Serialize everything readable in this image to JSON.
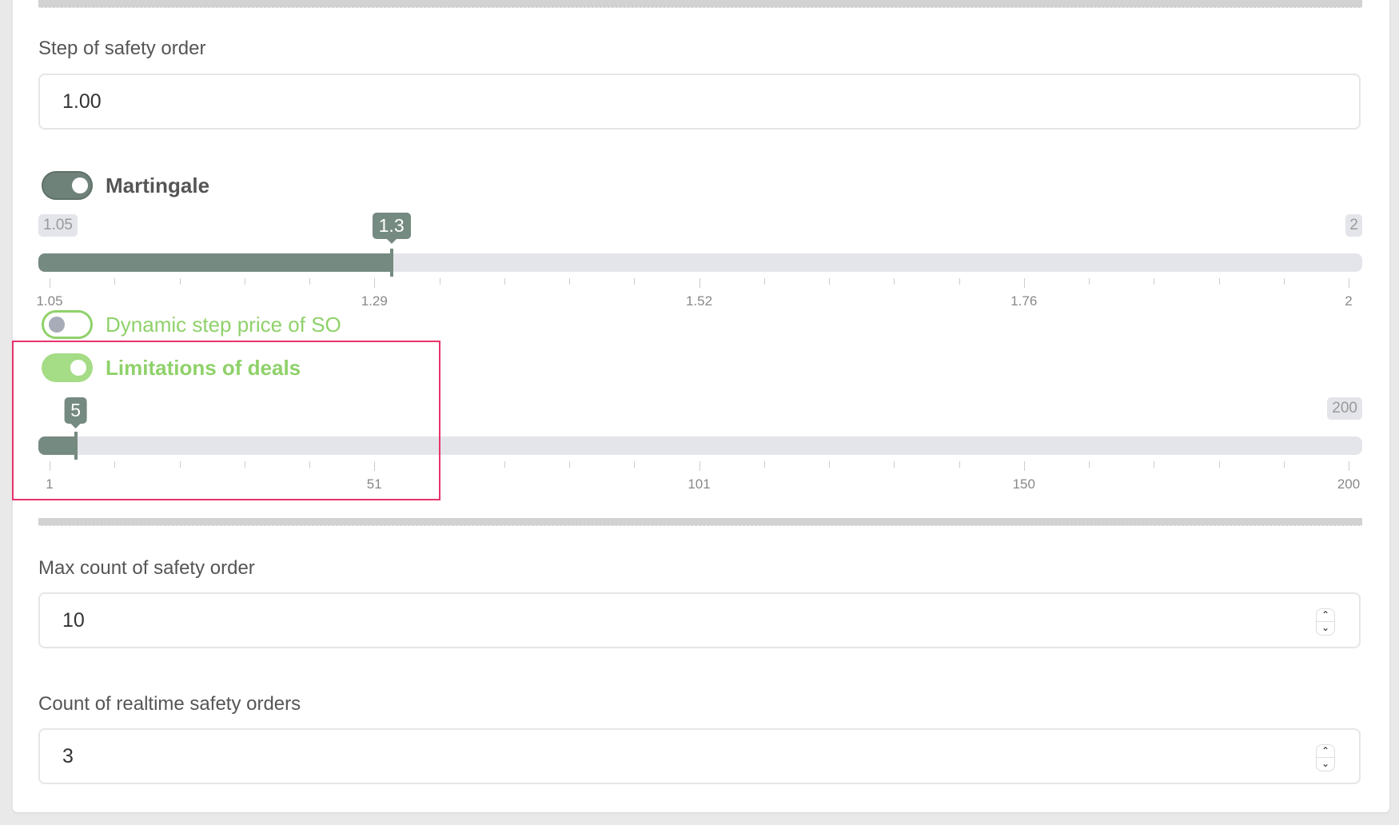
{
  "step_of_safety_order": {
    "label": "Step of safety order",
    "value": "1.00"
  },
  "martingale": {
    "label": "Martingale",
    "enabled": true,
    "slider": {
      "min_label": "1.05",
      "max_label": "2",
      "value": 1.3,
      "value_label": "1.3",
      "min": 1.05,
      "max": 2,
      "tick_labels": [
        "1.05",
        "1.29",
        "1.52",
        "1.76",
        "2"
      ]
    }
  },
  "dynamic_step": {
    "label": "Dynamic step price of SO",
    "enabled": false
  },
  "limitations_of_deals": {
    "label": "Limitations of deals",
    "enabled": true,
    "slider": {
      "max_label": "200",
      "value": 5,
      "value_label": "5",
      "min": 1,
      "max": 200,
      "tick_labels": [
        "1",
        "51",
        "101",
        "150",
        "200"
      ]
    }
  },
  "max_count_safety_order": {
    "label": "Max count of safety order",
    "value": "10"
  },
  "count_realtime_safety_orders": {
    "label": "Count of realtime safety orders",
    "value": "3"
  },
  "colors": {
    "slider_fill": "#758a80",
    "track": "#e4e5ea",
    "green": "#8fd16a",
    "highlight": "#e8336b"
  }
}
